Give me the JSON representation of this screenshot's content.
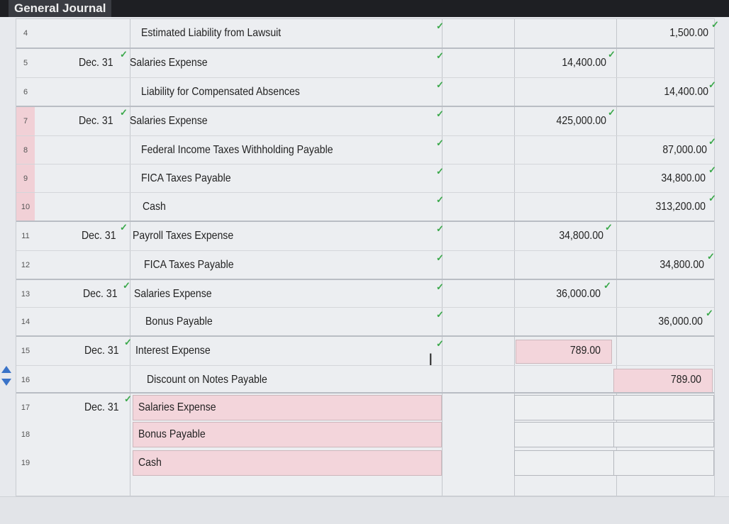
{
  "window": {
    "title": "General Journal"
  },
  "rows": [
    {
      "num": "4",
      "date": "",
      "account": "Estimated Liability from Lawsuit",
      "debit": "",
      "credit": "1,500.00"
    },
    {
      "num": "5",
      "date": "Dec. 31",
      "account": "Salaries Expense",
      "debit": "14,400.00",
      "credit": ""
    },
    {
      "num": "6",
      "date": "",
      "account": "Liability for Compensated Absences",
      "debit": "",
      "credit": "14,400.00"
    },
    {
      "num": "7",
      "date": "Dec. 31",
      "account": "Salaries Expense",
      "debit": "425,000.00",
      "credit": ""
    },
    {
      "num": "8",
      "date": "",
      "account": "Federal Income Taxes Withholding Payable",
      "debit": "",
      "credit": "87,000.00"
    },
    {
      "num": "9",
      "date": "",
      "account": "FICA Taxes Payable",
      "debit": "",
      "credit": "34,800.00"
    },
    {
      "num": "10",
      "date": "",
      "account": "Cash",
      "debit": "",
      "credit": "313,200.00"
    },
    {
      "num": "11",
      "date": "Dec. 31",
      "account": "Payroll Taxes Expense",
      "debit": "34,800.00",
      "credit": ""
    },
    {
      "num": "12",
      "date": "",
      "account": "FICA Taxes Payable",
      "debit": "",
      "credit": "34,800.00"
    },
    {
      "num": "13",
      "date": "Dec. 31",
      "account": "Salaries Expense",
      "debit": "36,000.00",
      "credit": ""
    },
    {
      "num": "14",
      "date": "",
      "account": "Bonus Payable",
      "debit": "",
      "credit": "36,000.00"
    },
    {
      "num": "15",
      "date": "Dec. 31",
      "account": "Interest Expense",
      "debit": "789.00",
      "credit": ""
    },
    {
      "num": "16",
      "date": "",
      "account": "Discount on Notes Payable",
      "debit": "",
      "credit": "789.00"
    },
    {
      "num": "17",
      "date": "Dec. 31",
      "account": "Salaries Expense",
      "debit": "",
      "credit": ""
    },
    {
      "num": "18",
      "date": "",
      "account": "Bonus Payable",
      "debit": "",
      "credit": ""
    },
    {
      "num": "19",
      "date": "",
      "account": "Cash",
      "debit": "",
      "credit": ""
    }
  ],
  "colors": {
    "pink_cell": "#f3d5db",
    "check_green": "#3aa84a",
    "titlebar": "#1e1f23",
    "scroll_arrow": "#3a73c8"
  },
  "icons": {
    "check": "✓",
    "cursor": "I"
  }
}
